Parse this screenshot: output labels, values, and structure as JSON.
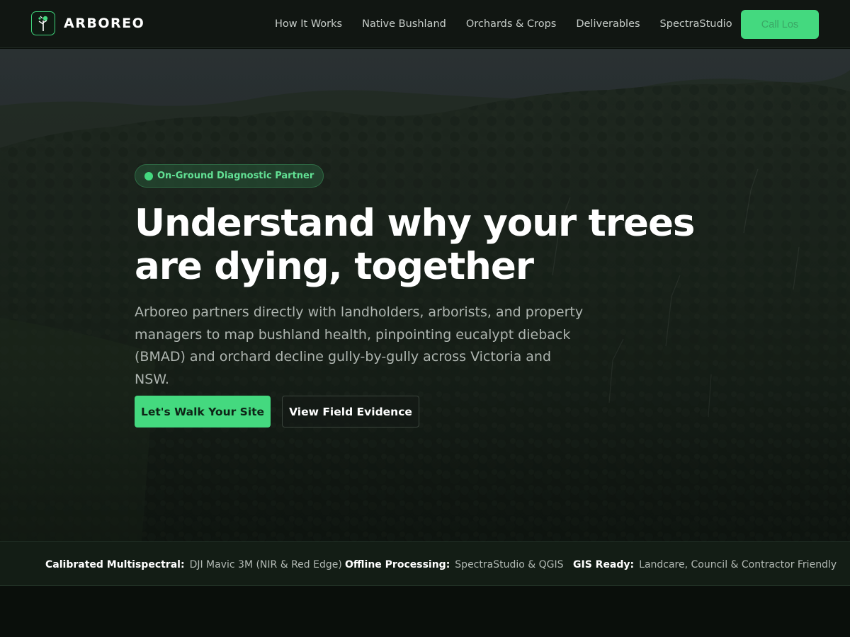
{
  "brand": {
    "name": "ARBOREO",
    "logo_icon": "tree-sapling-icon",
    "accent_color": "#44d97f"
  },
  "nav": {
    "links": [
      "How It Works",
      "Native Bushland",
      "Orchards & Crops",
      "Deliverables",
      "SpectraStudio"
    ],
    "cta_label": "Call Los"
  },
  "hero": {
    "badge": "On-Ground Diagnostic Partner",
    "title": "Understand why your trees are dying, together",
    "subtitle": "Arboreo partners directly with landholders, arborists, and property managers to map bushland health, pinpointing eucalypt dieback (BMAD) and orchard decline gully-by-gully across Victoria and NSW.",
    "primary_button": "Let's Walk Your Site",
    "secondary_button": "View Field Evidence",
    "background": "forested-hills-photo"
  },
  "strip": {
    "items": [
      {
        "label": "Calibrated Multispectral:",
        "value": "DJI Mavic 3M (NIR & Red Edge)"
      },
      {
        "label": "Offline Processing:",
        "value": "SpectraStudio & QGIS"
      },
      {
        "label": "GIS Ready:",
        "value": "Landcare, Council & Contractor Friendly"
      }
    ]
  }
}
